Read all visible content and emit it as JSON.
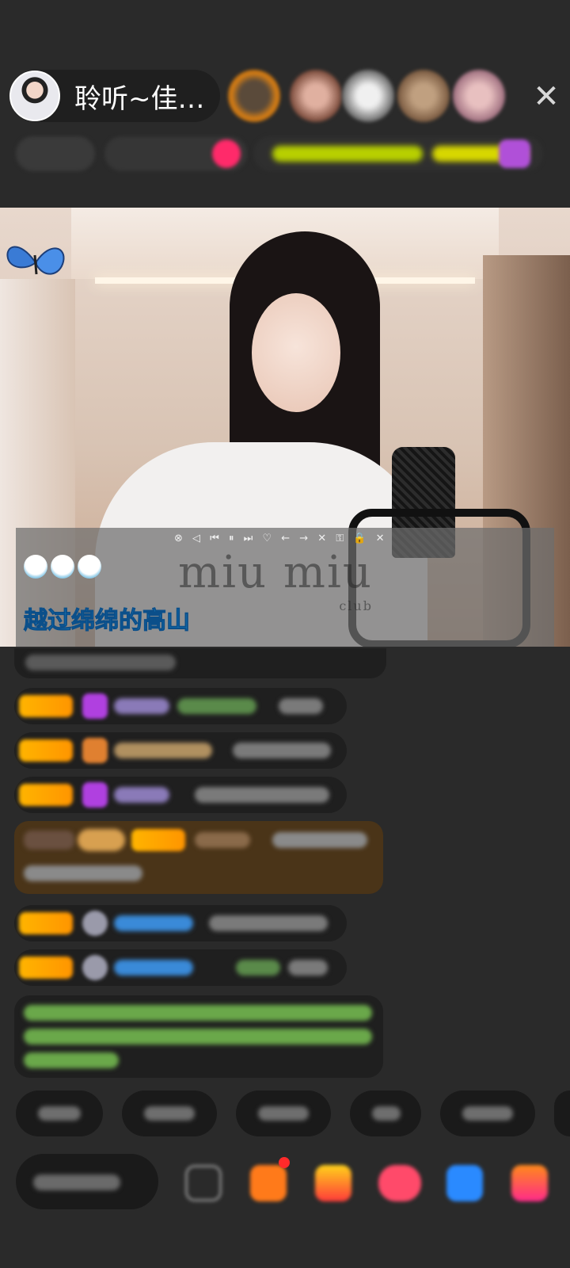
{
  "header": {
    "host_name": "聆听~佳…",
    "close_icon": "close-icon"
  },
  "video": {
    "player_controls": "⊗  ◁ ⏮ ⏸ ⏭ ♡   ← → ✕   ⚿ 🔒 ✕",
    "lyric": "越过绵绵的高山",
    "watermark": "miu miu",
    "watermark_sub": "club"
  },
  "colors": {
    "background": "#2a2a2a",
    "lyric": "#1d9fe6",
    "badge": "#ffb400"
  }
}
